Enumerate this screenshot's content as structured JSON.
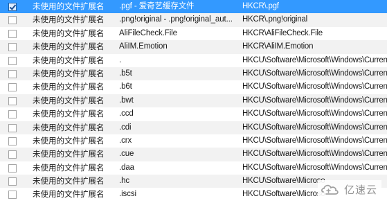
{
  "results": [
    {
      "type": "未使用的文件扩展名",
      "name": ".pgf - 爱奇艺缓存文件",
      "path": "HKCR\\.pgf",
      "checked": true,
      "selected": true
    },
    {
      "type": "未使用的文件扩展名",
      "name": ".png!original - .png!original_aut...",
      "path": "HKCR\\.png!original",
      "checked": false,
      "selected": false
    },
    {
      "type": "未使用的文件扩展名",
      "name": "AliFileCheck.File",
      "path": "HKCR\\AliFileCheck.File",
      "checked": false,
      "selected": false
    },
    {
      "type": "未使用的文件扩展名",
      "name": "AliIM.Emotion",
      "path": "HKCR\\AliIM.Emotion",
      "checked": false,
      "selected": false
    },
    {
      "type": "未使用的文件扩展名",
      "name": ".",
      "path": "HKCU\\Software\\Microsoft\\Windows\\CurrentV",
      "checked": false,
      "selected": false
    },
    {
      "type": "未使用的文件扩展名",
      "name": ".b5t",
      "path": "HKCU\\Software\\Microsoft\\Windows\\CurrentV",
      "checked": false,
      "selected": false
    },
    {
      "type": "未使用的文件扩展名",
      "name": ".b6t",
      "path": "HKCU\\Software\\Microsoft\\Windows\\CurrentV",
      "checked": false,
      "selected": false
    },
    {
      "type": "未使用的文件扩展名",
      "name": ".bwt",
      "path": "HKCU\\Software\\Microsoft\\Windows\\CurrentV",
      "checked": false,
      "selected": false
    },
    {
      "type": "未使用的文件扩展名",
      "name": ".ccd",
      "path": "HKCU\\Software\\Microsoft\\Windows\\CurrentV",
      "checked": false,
      "selected": false
    },
    {
      "type": "未使用的文件扩展名",
      "name": ".cdi",
      "path": "HKCU\\Software\\Microsoft\\Windows\\CurrentV",
      "checked": false,
      "selected": false
    },
    {
      "type": "未使用的文件扩展名",
      "name": ".crx",
      "path": "HKCU\\Software\\Microsoft\\Windows\\CurrentV",
      "checked": false,
      "selected": false
    },
    {
      "type": "未使用的文件扩展名",
      "name": ".cue",
      "path": "HKCU\\Software\\Microsoft\\Windows\\CurrentV",
      "checked": false,
      "selected": false
    },
    {
      "type": "未使用的文件扩展名",
      "name": ".daa",
      "path": "HKCU\\Software\\Microsoft\\Windows\\CurrentV",
      "checked": false,
      "selected": false
    },
    {
      "type": "未使用的文件扩展名",
      "name": ".hc",
      "path": "HKCU\\Software\\Microso",
      "checked": false,
      "selected": false
    },
    {
      "type": "未使用的文件扩展名",
      "name": ".iscsi",
      "path": "HKCU\\Software\\Microso",
      "checked": false,
      "selected": false
    }
  ],
  "watermark": {
    "text": "亿速云",
    "icon": "yisu-cloud-logo-icon"
  },
  "colors": {
    "selected_row": "#3399ff",
    "alt_row": "#f2f2f2",
    "text": "#1a1a1a"
  }
}
